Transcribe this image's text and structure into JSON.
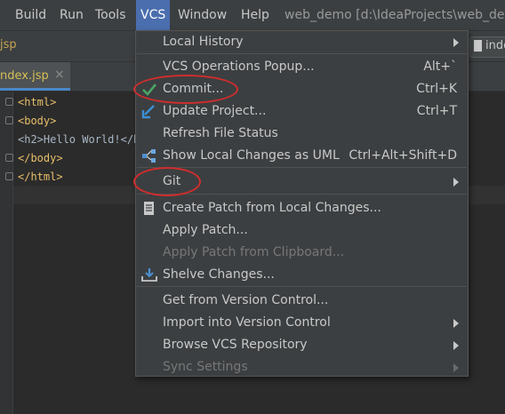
{
  "menubar": {
    "items": [
      "Build",
      "Run",
      "Tools",
      "VCS",
      "Window",
      "Help"
    ],
    "project_path": "web_demo [d:\\IdeaProjects\\web_dem"
  },
  "toolbar": {
    "breadcrumb": "jsp",
    "right_file": "inde"
  },
  "tabs": [
    {
      "label": "ndex.jsp",
      "close": "×"
    }
  ],
  "editor": {
    "lines": [
      "<html>",
      "<body>",
      "<h2>Hello World!</h",
      "</body>",
      "</html>"
    ]
  },
  "vcs_menu": {
    "items": [
      {
        "label": "Local History",
        "submenu": true
      },
      {
        "label": "VCS Operations Popup...",
        "shortcut": "Alt+`"
      },
      {
        "label": "Commit...",
        "shortcut": "Ctrl+K",
        "icon": "check-icon"
      },
      {
        "label": "Update Project...",
        "shortcut": "Ctrl+T",
        "icon": "update-arrow-icon"
      },
      {
        "label": "Refresh File Status"
      },
      {
        "label": "Show Local Changes as UML",
        "shortcut": "Ctrl+Alt+Shift+D",
        "icon": "uml-diagram-icon"
      },
      {
        "label": "Git",
        "submenu": true
      },
      {
        "label": "Create Patch from Local Changes...",
        "icon": "patch-file-icon"
      },
      {
        "label": "Apply Patch..."
      },
      {
        "label": "Apply Patch from Clipboard...",
        "disabled": true
      },
      {
        "label": "Shelve Changes...",
        "icon": "shelve-icon"
      },
      {
        "label": "Get from Version Control..."
      },
      {
        "label": "Import into Version Control",
        "submenu": true
      },
      {
        "label": "Browse VCS Repository",
        "submenu": true
      },
      {
        "label": "Sync Settings",
        "submenu": true,
        "disabled": true
      }
    ]
  },
  "colors": {
    "highlight": "#4b6eaf",
    "annotation": "#d12d2d",
    "check": "#4aa564",
    "update": "#3d8fd6"
  }
}
